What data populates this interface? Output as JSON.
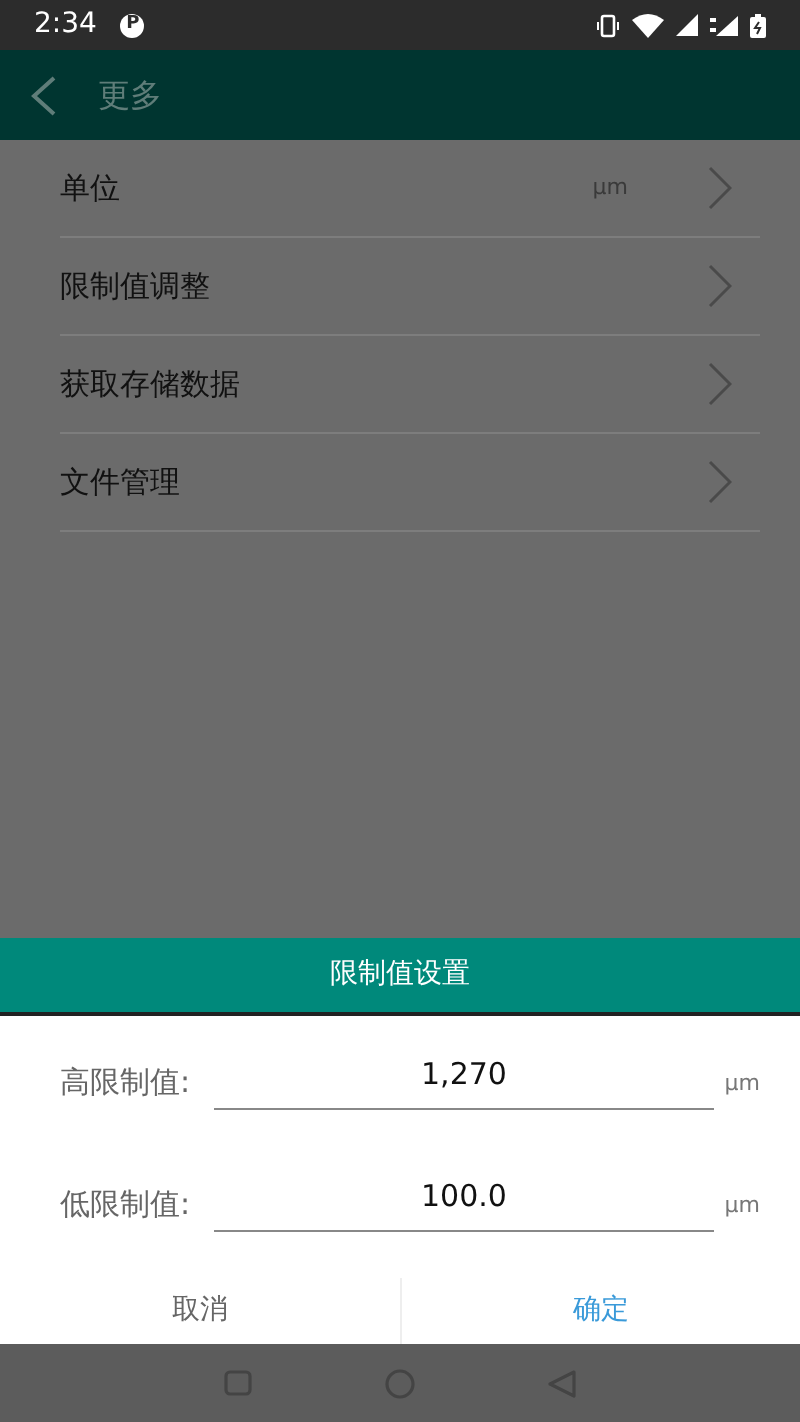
{
  "status_bar": {
    "time": "2:34",
    "notification": "P"
  },
  "header": {
    "title": "更多"
  },
  "menu": [
    {
      "label": "单位",
      "value": "μm"
    },
    {
      "label": "限制值调整"
    },
    {
      "label": "获取存储数据"
    },
    {
      "label": "文件管理"
    }
  ],
  "dialog": {
    "title": "限制值设置",
    "fields": [
      {
        "label": "高限制值:",
        "value": "1,270",
        "unit": "μm"
      },
      {
        "label": "低限制值:",
        "value": "100.0",
        "unit": "μm"
      }
    ],
    "buttons": [
      {
        "label": "取消",
        "kind": "cancel"
      },
      {
        "label": "确定",
        "kind": "confirm"
      }
    ]
  }
}
